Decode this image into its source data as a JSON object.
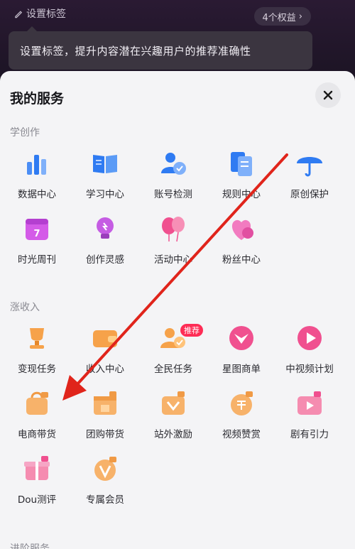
{
  "top": {
    "tag_button": "设置标签",
    "rights_button": "4个权益",
    "tooltip": "设置标签，提升内容潜在兴趣用户的推荐准确性"
  },
  "sheet": {
    "title": "我的服务",
    "sections": [
      {
        "label": "学创作",
        "items": [
          {
            "label": "数据中心",
            "icon": "bar-chart-icon"
          },
          {
            "label": "学习中心",
            "icon": "open-book-icon"
          },
          {
            "label": "账号检测",
            "icon": "account-check-icon"
          },
          {
            "label": "规则中心",
            "icon": "rules-document-icon"
          },
          {
            "label": "原创保护",
            "icon": "umbrella-icon"
          },
          {
            "label": "时光周刊",
            "icon": "calendar-icon"
          },
          {
            "label": "创作灵感",
            "icon": "lightbulb-icon"
          },
          {
            "label": "活动中心",
            "icon": "balloon-icon"
          },
          {
            "label": "粉丝中心",
            "icon": "heart-icon"
          }
        ]
      },
      {
        "label": "涨收入",
        "items": [
          {
            "label": "变现任务",
            "icon": "trophy-icon"
          },
          {
            "label": "收入中心",
            "icon": "wallet-icon"
          },
          {
            "label": "全民任务",
            "icon": "people-task-icon",
            "badge": "推荐"
          },
          {
            "label": "星图商单",
            "icon": "star-map-icon"
          },
          {
            "label": "中视频计划",
            "icon": "play-video-icon"
          },
          {
            "label": "电商带货",
            "icon": "shopping-bag-icon"
          },
          {
            "label": "团购带货",
            "icon": "group-buy-icon"
          },
          {
            "label": "站外激励",
            "icon": "incentive-icon"
          },
          {
            "label": "视频赞赏",
            "icon": "reward-coin-icon"
          },
          {
            "label": "剧有引力",
            "icon": "drama-icon"
          },
          {
            "label": "Dou测评",
            "icon": "gift-box-icon"
          },
          {
            "label": "专属会员",
            "icon": "vip-member-icon"
          }
        ]
      },
      {
        "label": "进阶服务"
      }
    ]
  },
  "colors": {
    "accent": "#fe2c55",
    "blue": "#2f7bf2",
    "orange": "#f6a24a",
    "pink": "#f0508f",
    "annotation": "#e0241b"
  }
}
